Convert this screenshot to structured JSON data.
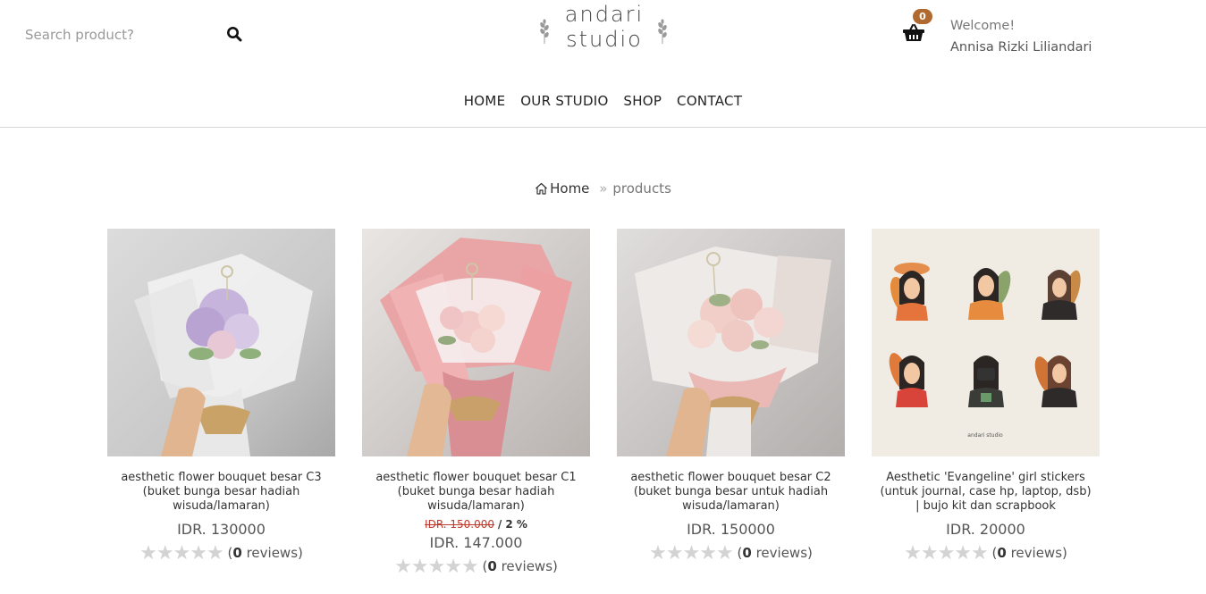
{
  "header": {
    "search_placeholder": "Search product?",
    "logo_line1": "andari",
    "logo_line2": "studio",
    "cart_count": "0",
    "welcome_label": "Welcome!",
    "user_name": "Annisa Rizki Liliandari"
  },
  "nav": [
    {
      "label": "HOME"
    },
    {
      "label": "OUR STUDIO"
    },
    {
      "label": "SHOP"
    },
    {
      "label": "CONTACT"
    }
  ],
  "breadcrumb": {
    "home": "Home",
    "separator": "»",
    "current": "products"
  },
  "products": [
    {
      "title": "aesthetic flower bouquet besar C3 (buket bunga besar hadiah wisuda/lamaran)",
      "price": "IDR. 130000",
      "old_price": "",
      "discount": "",
      "reviews_count": "0",
      "reviews_label": "reviews",
      "image_color": "purple-bouquet"
    },
    {
      "title": "aesthetic flower bouquet besar C1 (buket bunga besar hadiah wisuda/lamaran)",
      "price": "IDR. 147.000",
      "old_price": "IDR. 150.000",
      "discount": "/ 2 %",
      "reviews_count": "0",
      "reviews_label": "reviews",
      "image_color": "pink-bouquet"
    },
    {
      "title": "aesthetic flower bouquet besar C2 (buket bunga besar untuk hadiah wisuda/lamaran)",
      "price": "IDR. 150000",
      "old_price": "",
      "discount": "",
      "reviews_count": "0",
      "reviews_label": "reviews",
      "image_color": "peach-bouquet"
    },
    {
      "title": "Aesthetic 'Evangeline' girl stickers (untuk journal, case hp, laptop, dsb) | bujo kit dan scrapbook",
      "price": "IDR. 20000",
      "old_price": "",
      "discount": "",
      "reviews_count": "0",
      "reviews_label": "reviews",
      "image_color": "sticker-sheet",
      "image_caption": "andari studio"
    }
  ]
}
